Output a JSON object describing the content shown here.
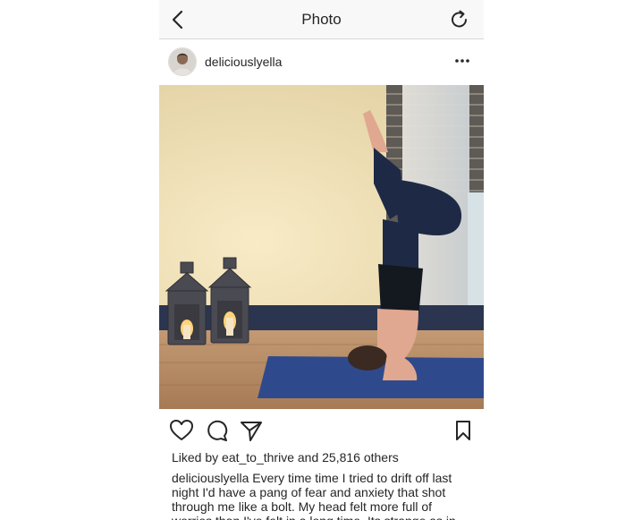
{
  "nav": {
    "title": "Photo",
    "back_icon": "chevron-left-icon",
    "refresh_icon": "refresh-icon"
  },
  "post": {
    "username": "deliciouslyella",
    "more_icon": "more-horizontal-icon"
  },
  "actions": {
    "like_icon": "heart-icon",
    "comment_icon": "comment-icon",
    "share_icon": "send-icon",
    "save_icon": "bookmark-icon"
  },
  "likes": {
    "prefix": "Liked by ",
    "liker": "eat_to_thrive",
    "suffix": " and 25,816 others"
  },
  "caption": {
    "username": "deliciouslyella",
    "text": " Every time time I tried to drift off last night I'd have a pang of fear and anxiety that shot through me like a bolt. My head felt more full of worries than I've felt in a long time. Its strange as in"
  },
  "colors": {
    "text": "#262626",
    "nav_bg": "#f8f8f8",
    "divider": "#d9d9d9"
  }
}
